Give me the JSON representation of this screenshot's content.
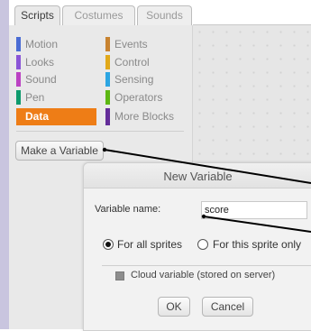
{
  "tabs": [
    {
      "label": "Scripts",
      "active": true
    },
    {
      "label": "Costumes",
      "active": false
    },
    {
      "label": "Sounds",
      "active": false
    }
  ],
  "categories": [
    {
      "label": "Motion",
      "color": "#4a6cd4"
    },
    {
      "label": "Looks",
      "color": "#8a55d7"
    },
    {
      "label": "Sound",
      "color": "#bb42c3"
    },
    {
      "label": "Pen",
      "color": "#0e9a6c"
    },
    {
      "label": "Data",
      "color": "#ee7d16",
      "selected": true
    },
    {
      "label": "Events",
      "color": "#c88330"
    },
    {
      "label": "Control",
      "color": "#e1a91a"
    },
    {
      "label": "Sensing",
      "color": "#2ca5e2"
    },
    {
      "label": "Operators",
      "color": "#5cb712"
    },
    {
      "label": "More Blocks",
      "color": "#632d99"
    }
  ],
  "make_variable_button": "Make a Variable",
  "dialog": {
    "title": "New Variable",
    "name_label": "Variable name:",
    "name_value": "score",
    "radio_all": "For all sprites",
    "radio_this": "For this sprite only",
    "cloud_label": "Cloud variable (stored on server)",
    "ok": "OK",
    "cancel": "Cancel"
  }
}
